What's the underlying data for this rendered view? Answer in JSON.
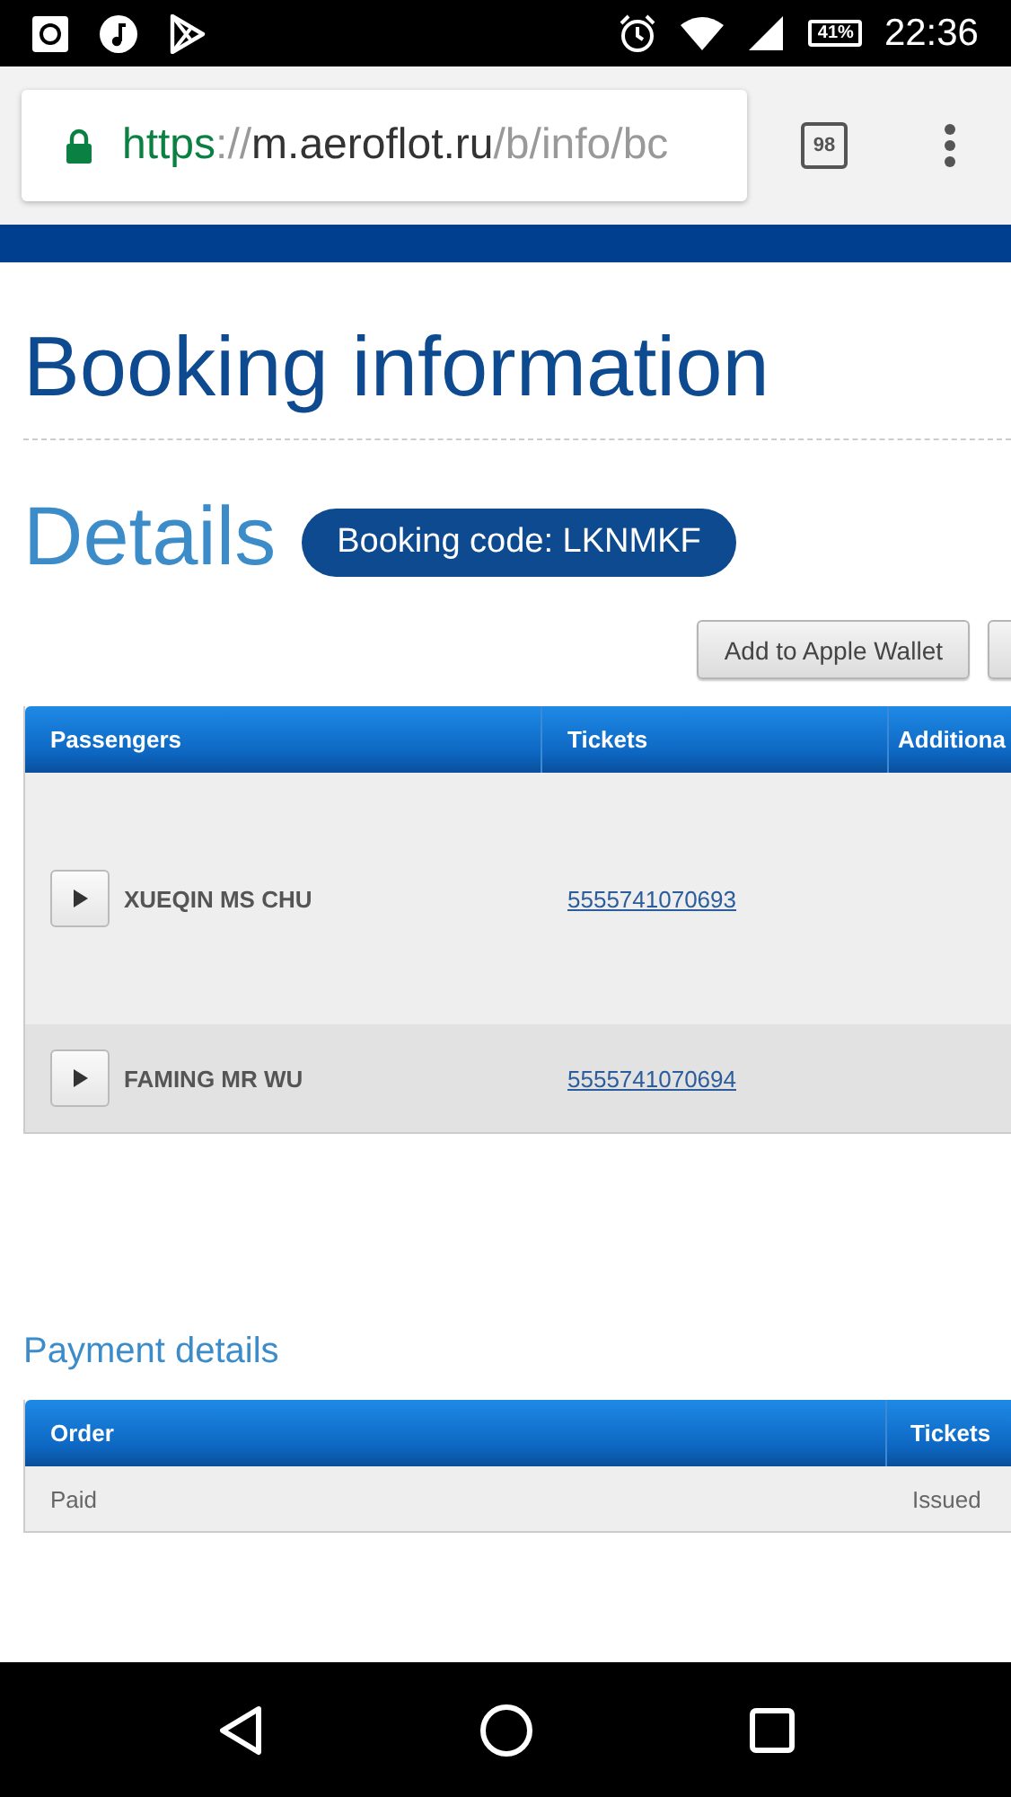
{
  "status_bar": {
    "battery": "41%",
    "time": "22:36"
  },
  "browser": {
    "url": {
      "scheme": "https",
      "separator": "://",
      "host": "m.aeroflot.ru",
      "path": "/b/info/bc"
    },
    "tab_count": "98"
  },
  "page": {
    "title": "Booking information",
    "section_title": "Details",
    "booking_code": "Booking code: LKNMKF",
    "buttons": [
      "Add to Apple Wallet"
    ],
    "passengers_table": {
      "columns": [
        "Passengers",
        "Tickets",
        "Additiona"
      ],
      "rows": [
        {
          "name": "XUEQIN MS CHU",
          "ticket": "5555741070693",
          "expanded": false
        },
        {
          "name": "FAMING MR WU",
          "ticket": "5555741070694",
          "expanded": false
        }
      ]
    },
    "payment": {
      "title": "Payment details",
      "columns": [
        "Order",
        "Tickets"
      ],
      "rows": [
        [
          "Paid",
          "Issued"
        ]
      ]
    }
  }
}
